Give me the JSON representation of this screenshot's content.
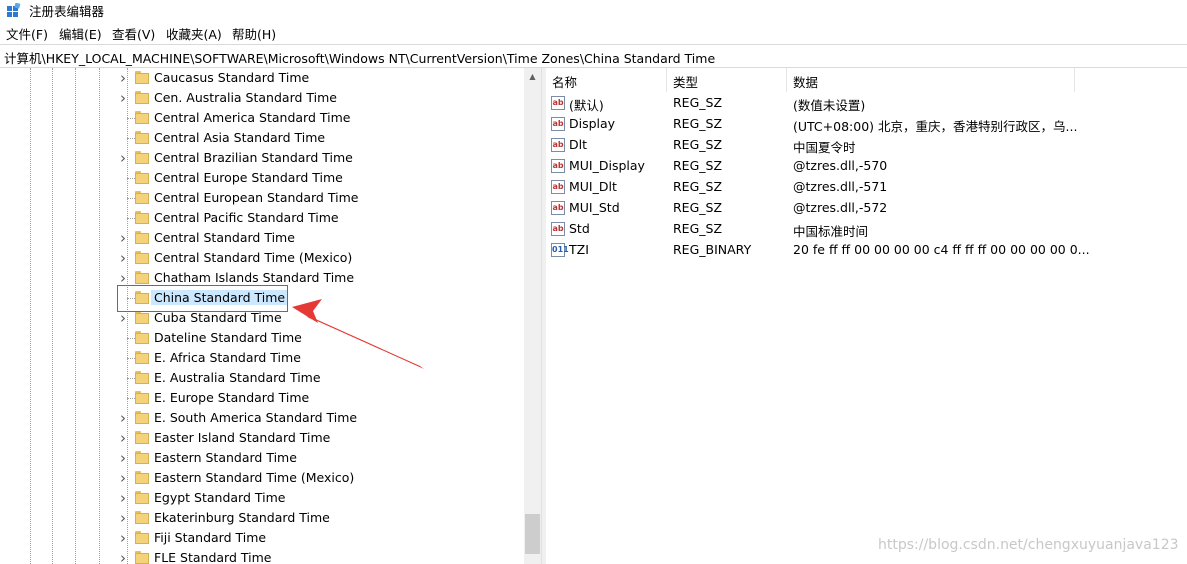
{
  "window": {
    "title": "注册表编辑器"
  },
  "menu": [
    "文件(F)",
    "编辑(E)",
    "查看(V)",
    "收藏夹(A)",
    "帮助(H)"
  ],
  "address": "计算机\\HKEY_LOCAL_MACHINE\\SOFTWARE\\Microsoft\\Windows NT\\CurrentVersion\\Time Zones\\China Standard Time",
  "tree": [
    {
      "label": "Caucasus Standard Time",
      "expandable": true
    },
    {
      "label": "Cen. Australia Standard Time",
      "expandable": true
    },
    {
      "label": "Central America Standard Time",
      "expandable": false
    },
    {
      "label": "Central Asia Standard Time",
      "expandable": false
    },
    {
      "label": "Central Brazilian Standard Time",
      "expandable": true
    },
    {
      "label": "Central Europe Standard Time",
      "expandable": false
    },
    {
      "label": "Central European Standard Time",
      "expandable": false
    },
    {
      "label": "Central Pacific Standard Time",
      "expandable": false
    },
    {
      "label": "Central Standard Time",
      "expandable": true
    },
    {
      "label": "Central Standard Time (Mexico)",
      "expandable": true
    },
    {
      "label": "Chatham Islands Standard Time",
      "expandable": true
    },
    {
      "label": "China Standard Time",
      "expandable": false,
      "selected": true
    },
    {
      "label": "Cuba Standard Time",
      "expandable": true
    },
    {
      "label": "Dateline Standard Time",
      "expandable": false
    },
    {
      "label": "E. Africa Standard Time",
      "expandable": false
    },
    {
      "label": "E. Australia Standard Time",
      "expandable": false
    },
    {
      "label": "E. Europe Standard Time",
      "expandable": false
    },
    {
      "label": "E. South America Standard Time",
      "expandable": true
    },
    {
      "label": "Easter Island Standard Time",
      "expandable": true
    },
    {
      "label": "Eastern Standard Time",
      "expandable": true
    },
    {
      "label": "Eastern Standard Time (Mexico)",
      "expandable": true
    },
    {
      "label": "Egypt Standard Time",
      "expandable": true
    },
    {
      "label": "Ekaterinburg Standard Time",
      "expandable": true
    },
    {
      "label": "Fiji Standard Time",
      "expandable": true
    },
    {
      "label": "FLE Standard Time",
      "expandable": true
    }
  ],
  "columns": {
    "name": "名称",
    "type": "类型",
    "data": "数据"
  },
  "values": [
    {
      "name": "(默认)",
      "type": "REG_SZ",
      "data": "(数值未设置)",
      "icon": "string-value-icon"
    },
    {
      "name": "Display",
      "type": "REG_SZ",
      "data": "(UTC+08:00) 北京，重庆，香港特别行政区，乌...",
      "icon": "string-value-icon"
    },
    {
      "name": "Dlt",
      "type": "REG_SZ",
      "data": "中国夏令时",
      "icon": "string-value-icon"
    },
    {
      "name": "MUI_Display",
      "type": "REG_SZ",
      "data": "@tzres.dll,-570",
      "icon": "string-value-icon"
    },
    {
      "name": "MUI_Dlt",
      "type": "REG_SZ",
      "data": "@tzres.dll,-571",
      "icon": "string-value-icon"
    },
    {
      "name": "MUI_Std",
      "type": "REG_SZ",
      "data": "@tzres.dll,-572",
      "icon": "string-value-icon"
    },
    {
      "name": "Std",
      "type": "REG_SZ",
      "data": "中国标准时间",
      "icon": "string-value-icon"
    },
    {
      "name": "TZI",
      "type": "REG_BINARY",
      "data": "20 fe ff ff 00 00 00 00 c4 ff ff ff 00 00 00 00 0...",
      "icon": "binary-value-icon"
    }
  ],
  "watermark": "https://blog.csdn.net/chengxuyuanjava123",
  "colors": {
    "selection": "#cce8ff",
    "annotation": "#e53935",
    "folder": "#f4d27a"
  }
}
